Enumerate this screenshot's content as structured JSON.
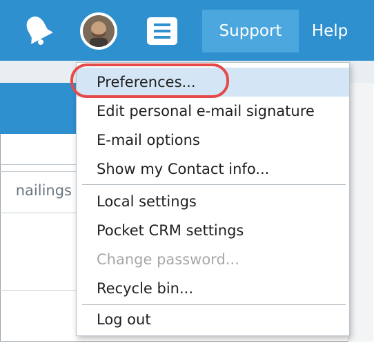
{
  "topbar": {
    "support_label": "Support",
    "help_label": "Help",
    "icons": [
      "bell-icon",
      "avatar",
      "hamburger-menu-icon"
    ],
    "bg_color": "#2f90cf"
  },
  "left_panel": {
    "mailings_label": "nailings"
  },
  "dropdown": {
    "items": [
      {
        "label": "Preferences...",
        "state": "selected"
      },
      {
        "label": "Edit personal e-mail signature",
        "state": "normal"
      },
      {
        "label": "E-mail options",
        "state": "normal"
      },
      {
        "label": "Show my Contact info...",
        "state": "normal"
      },
      {
        "label": "Local settings",
        "state": "normal"
      },
      {
        "label": "Pocket CRM settings",
        "state": "normal"
      },
      {
        "label": "Change password...",
        "state": "disabled"
      },
      {
        "label": "Recycle bin...",
        "state": "normal"
      },
      {
        "label": "Log out",
        "state": "normal"
      }
    ],
    "highlight_color": "#e54a4a",
    "selected_color": "#d4e6f5"
  }
}
